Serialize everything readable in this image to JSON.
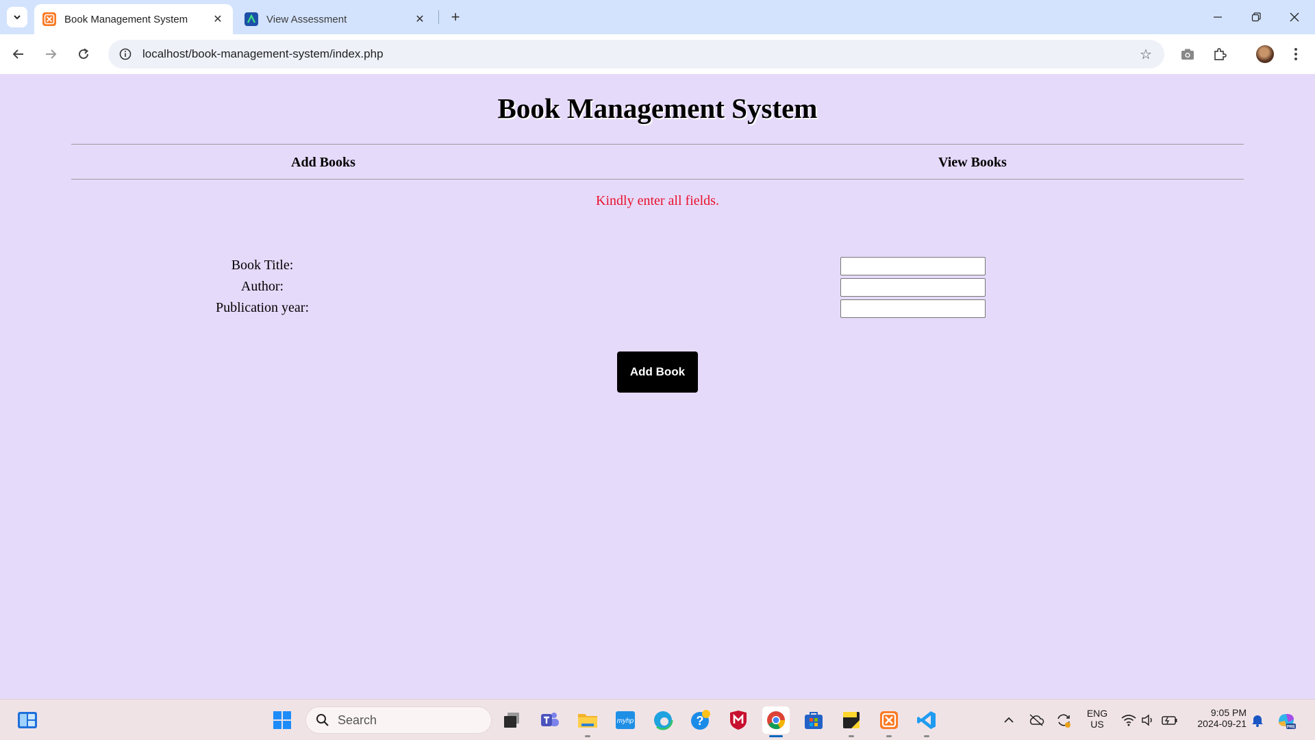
{
  "browser": {
    "tabs": [
      {
        "title": "Book Management System",
        "icon": "xampp-icon",
        "active": true
      },
      {
        "title": "View Assessment",
        "icon": "assessment-icon",
        "active": false
      }
    ],
    "url": "localhost/book-management-system/index.php"
  },
  "page": {
    "title": "Book Management System",
    "nav": {
      "add_books": "Add Books",
      "view_books": "View Books"
    },
    "error_message": "Kindly enter all fields.",
    "form": {
      "fields": [
        {
          "label": "Book Title:",
          "value": ""
        },
        {
          "label": "Author:",
          "value": ""
        },
        {
          "label": "Publication year:",
          "value": ""
        }
      ],
      "submit_label": "Add Book"
    }
  },
  "taskbar": {
    "search_placeholder": "Search",
    "language": "ENG",
    "region": "US",
    "time": "9:05 PM",
    "date": "2024-09-21"
  },
  "colors": {
    "page_background": "#e6dafa",
    "error_text": "#e8112d",
    "button_background": "#000000",
    "tabbar_background": "#d3e3fd"
  }
}
